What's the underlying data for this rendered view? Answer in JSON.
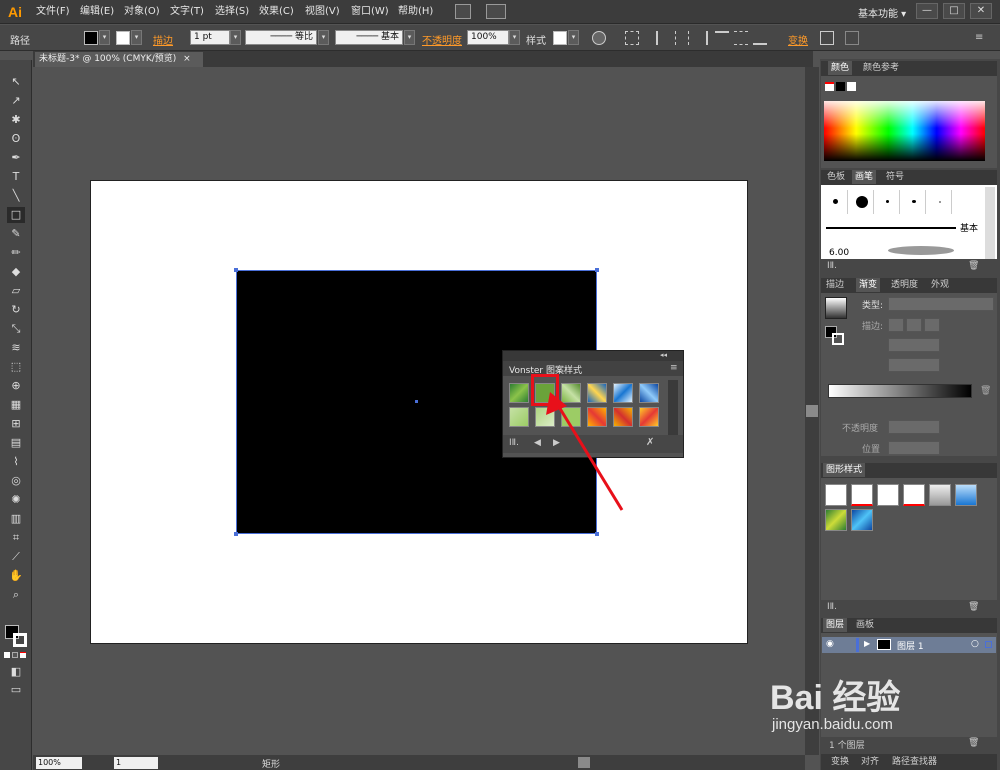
{
  "app": {
    "logo": "Ai"
  },
  "menu": [
    "文件(F)",
    "编辑(E)",
    "对象(O)",
    "文字(T)",
    "选择(S)",
    "效果(C)",
    "视图(V)",
    "窗口(W)",
    "帮助(H)"
  ],
  "workspace": "基本功能",
  "window_controls": [
    "—",
    "□",
    "✕"
  ],
  "control_bar": {
    "selection_label": "路径",
    "stroke_label": "描边",
    "stroke_weight": "1 pt",
    "profile_label": "等比",
    "brush_label": "基本",
    "opacity_label": "不透明度",
    "opacity_value": "100%",
    "style_label": "样式",
    "transform_label": "变换"
  },
  "document": {
    "tab_title": "未标题-3* @ 100% (CMYK/预览)",
    "tab_close": "×",
    "zoom": "100%",
    "page": "1",
    "current_tool": "矩形"
  },
  "pattern_panel": {
    "title": "Vonster 图案样式",
    "colors": [
      "#4caf50",
      "#7bbf3a",
      "#8fcf4a",
      "#1f5fa8",
      "#2f74c0",
      "#2e6fb5",
      "#a8d060",
      "#b9dc7a",
      "#9ccc65",
      "#e53935",
      "#f4b400",
      "#f4b400"
    ]
  },
  "panels": {
    "color_tabs": [
      "色板",
      "颜色参考"
    ],
    "color_tab_labels": [
      "颜色",
      "颜色参考"
    ],
    "brush_tabs": [
      "色板",
      "画笔",
      "符号"
    ],
    "brush_basic": "基本",
    "brush_size": "6.00",
    "gradient_tabs": [
      "描边",
      "渐变",
      "透明度",
      "外观"
    ],
    "gradient_type_label": "类型:",
    "gradient_stroke_label": "描边:",
    "gradient_opacity_label": "不透明度",
    "gradient_location_label": "位置",
    "graphic_styles_tab": "图形样式",
    "layers_tabs": [
      "图层",
      "画板"
    ],
    "layer_name": "图层 1",
    "layer_count": "1 个图层",
    "bottom_tabs": [
      "变换",
      "对齐",
      "路径查找器"
    ]
  },
  "accent": {
    "orange": "#ff9a00",
    "selection": "#4a6fd8",
    "arrow": "#e8101a"
  },
  "watermark": {
    "brand": "Bai 经验",
    "url": "jingyan.baidu.com"
  }
}
